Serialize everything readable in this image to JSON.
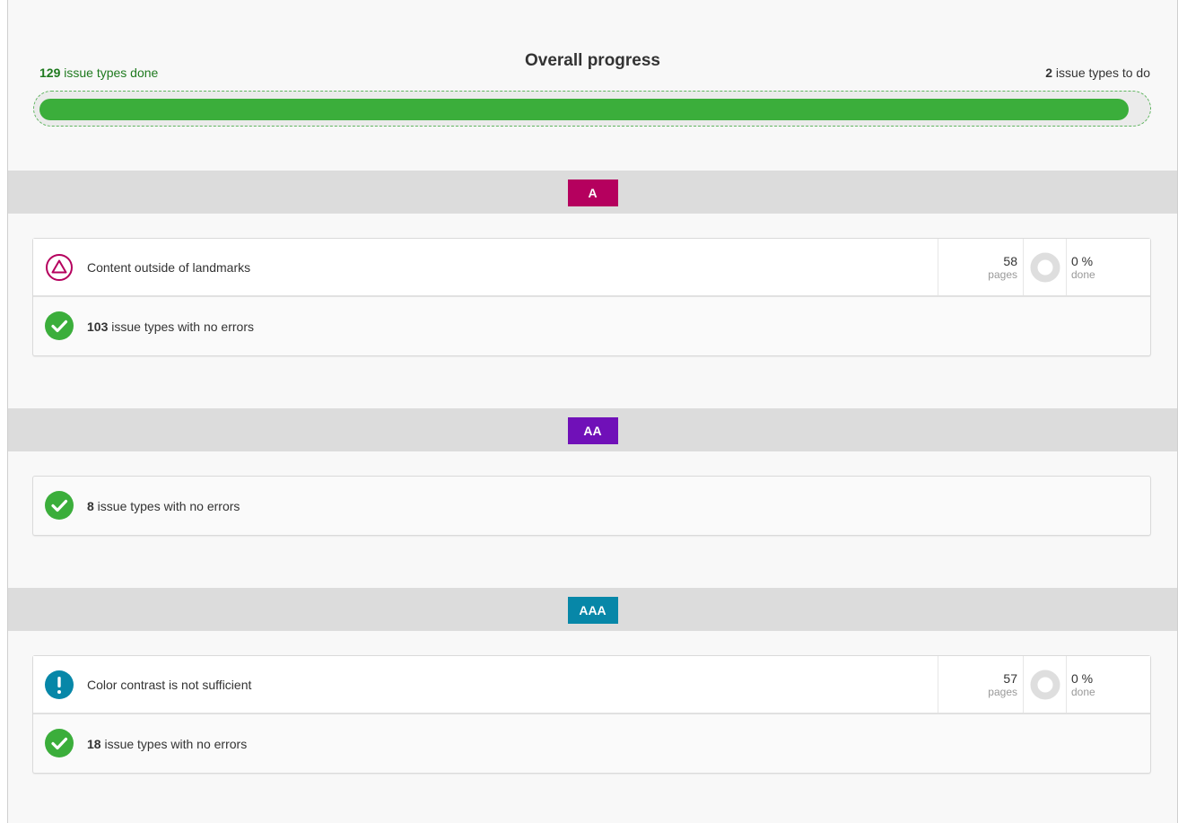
{
  "progress": {
    "title": "Overall progress",
    "done_count": "129",
    "done_text": " issue types done",
    "todo_count": "2",
    "todo_text": " issue types to do",
    "fraction_done": 0.985,
    "fill_color": "#3bae3b"
  },
  "levels": [
    {
      "badge": "A",
      "badge_color": "#b5005e",
      "issues": [
        {
          "icon": "triangle-warning-icon",
          "label": "Content outside of landmarks",
          "pages": "58",
          "pages_unit": "pages",
          "done": "0 %",
          "done_unit": "done"
        }
      ],
      "ok_count": "103",
      "ok_text": " issue types with no errors"
    },
    {
      "badge": "AA",
      "badge_color": "#7010b8",
      "issues": [],
      "ok_count": "8",
      "ok_text": " issue types with no errors"
    },
    {
      "badge": "AAA",
      "badge_color": "#0787a8",
      "issues": [
        {
          "icon": "exclamation-icon",
          "label": "Color contrast is not sufficient",
          "pages": "57",
          "pages_unit": "pages",
          "done": "0 %",
          "done_unit": "done"
        }
      ],
      "ok_count": "18",
      "ok_text": " issue types with no errors"
    }
  ]
}
